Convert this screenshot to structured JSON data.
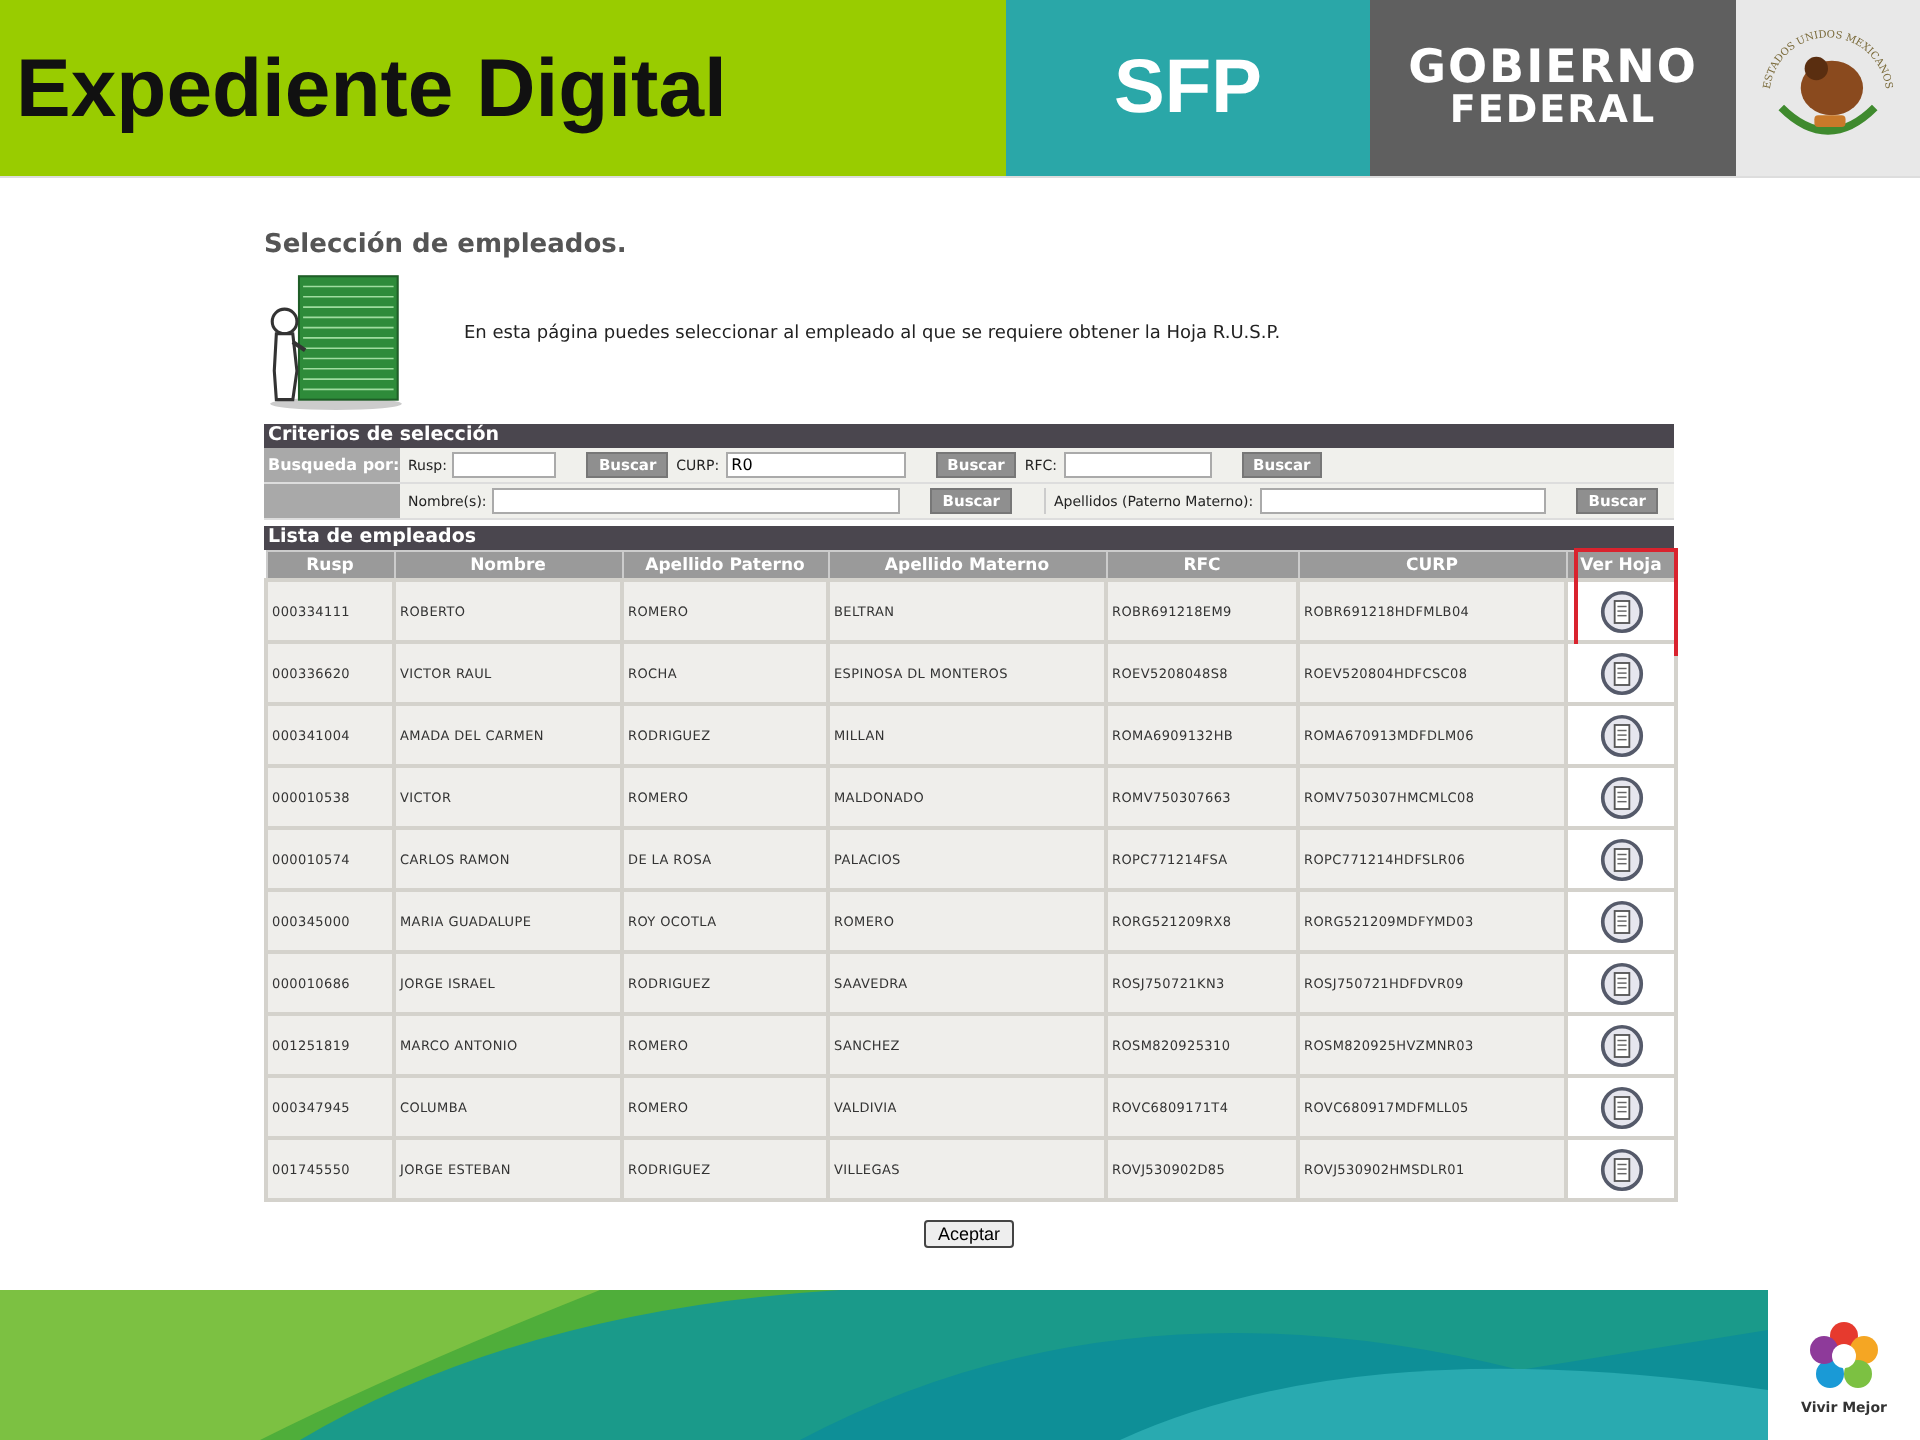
{
  "header": {
    "title": "Expediente Digital",
    "agency": "SFP",
    "government": [
      "GOBIERNO",
      "FEDERAL"
    ],
    "seal_text": "ESTADOS UNIDOS MEXICANOS"
  },
  "page": {
    "heading": "Selección de empleados.",
    "intro": "En esta página puedes seleccionar al empleado al que se requiere obtener la Hoja R.U.S.P."
  },
  "criteria": {
    "title": "Criterios de selección",
    "search_by": "Busqueda por:",
    "fields_row_1": [
      {
        "label": "Rusp:",
        "button": "Buscar"
      },
      {
        "label": "CURP:",
        "value": "R0",
        "button": "Buscar"
      },
      {
        "label": "RFC:",
        "button": "Buscar"
      }
    ],
    "fields_row_2": [
      {
        "label": "Nombre(s):",
        "button": "Buscar"
      },
      {
        "label": "Apellidos (Paterno Materno):",
        "button": "Buscar"
      }
    ]
  },
  "table": {
    "title": "Lista de empleados",
    "columns": [
      "Rusp",
      "Nombre",
      "Apellido Paterno",
      "Apellido Materno",
      "RFC",
      "CURP",
      "Ver Hoja"
    ],
    "rows": [
      {
        "cells": [
          "000334111",
          "ROBERTO",
          "ROMERO",
          "BELTRAN",
          "ROBR691218EM9",
          "ROBR691218HDFMLB04"
        ],
        "highlighted": true
      },
      {
        "cells": [
          "000336620",
          "VICTOR RAUL",
          "ROCHA",
          "ESPINOSA DL MONTEROS",
          "ROEV5208048S8",
          "ROEV520804HDFCSC08"
        ],
        "highlighted": false
      },
      {
        "cells": [
          "000341004",
          "AMADA DEL CARMEN",
          "RODRIGUEZ",
          "MILLAN",
          "ROMA6909132HB",
          "ROMA670913MDFDLM06"
        ],
        "highlighted": false
      },
      {
        "cells": [
          "000010538",
          "VICTOR",
          "ROMERO",
          "MALDONADO",
          "ROMV750307663",
          "ROMV750307HMCMLC08"
        ],
        "highlighted": false
      },
      {
        "cells": [
          "000010574",
          "CARLOS RAMON",
          "DE LA ROSA",
          "PALACIOS",
          "ROPC771214FSA",
          "ROPC771214HDFSLR06"
        ],
        "highlighted": false
      },
      {
        "cells": [
          "000345000",
          "MARIA GUADALUPE",
          "ROY OCOTLA",
          "ROMERO",
          "RORG521209RX8",
          "RORG521209MDFYMD03"
        ],
        "highlighted": false
      },
      {
        "cells": [
          "000010686",
          "JORGE ISRAEL",
          "RODRIGUEZ",
          "SAAVEDRA",
          "ROSJ750721KN3",
          "ROSJ750721HDFDVR09"
        ],
        "highlighted": false
      },
      {
        "cells": [
          "001251819",
          "MARCO ANTONIO",
          "ROMERO",
          "SANCHEZ",
          "ROSM820925310",
          "ROSM820925HVZMNR03"
        ],
        "highlighted": false
      },
      {
        "cells": [
          "000347945",
          "COLUMBA",
          "ROMERO",
          "VALDIVIA",
          "ROVC6809171T4",
          "ROVC680917MDFMLL05"
        ],
        "highlighted": false
      },
      {
        "cells": [
          "001745550",
          "JORGE ESTEBAN",
          "RODRIGUEZ",
          "VILLEGAS",
          "ROVJ530902D85",
          "ROVJ530902HMSDLR01"
        ],
        "highlighted": false
      }
    ]
  },
  "accept_button": "Aceptar",
  "footer": {
    "logo_text": "Vivir Mejor"
  }
}
